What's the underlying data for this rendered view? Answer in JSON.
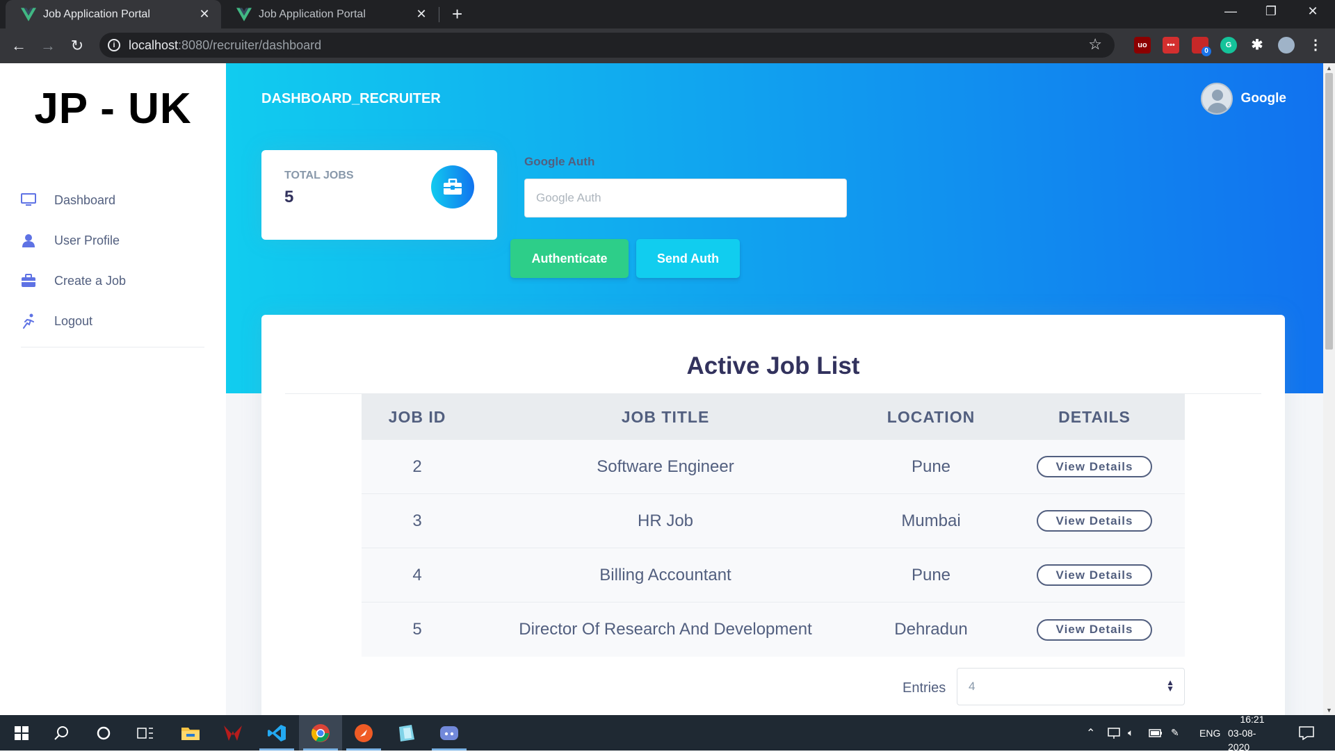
{
  "browser": {
    "tabs": [
      {
        "title": "Job Application Portal",
        "close": "✕"
      },
      {
        "title": "Job Application Portal",
        "close": "✕"
      }
    ],
    "new_tab": "+",
    "url_host": "localhost",
    "url_rest": ":8080/recruiter/dashboard",
    "extension_badge": "0"
  },
  "sidebar": {
    "brand": "JP - UK",
    "items": [
      {
        "label": "Dashboard",
        "icon": "monitor-icon"
      },
      {
        "label": "User Profile",
        "icon": "user-icon"
      },
      {
        "label": "Create a Job",
        "icon": "briefcase-icon"
      },
      {
        "label": "Logout",
        "icon": "run-icon"
      }
    ]
  },
  "header": {
    "title": "DASHBOARD_RECRUITER",
    "user_name": "Google"
  },
  "stats": {
    "label": "TOTAL JOBS",
    "value": "5"
  },
  "auth": {
    "label": "Google Auth",
    "placeholder": "Google Auth",
    "authenticate_label": "Authenticate",
    "send_label": "Send Auth"
  },
  "jobs": {
    "title": "Active Job List",
    "columns": [
      "JOB ID",
      "JOB TITLE",
      "LOCATION",
      "DETAILS"
    ],
    "rows": [
      {
        "id": "2",
        "title": "Software Engineer",
        "location": "Pune",
        "action": "View Details"
      },
      {
        "id": "3",
        "title": "HR Job",
        "location": "Mumbai",
        "action": "View Details"
      },
      {
        "id": "4",
        "title": "Billing Accountant",
        "location": "Pune",
        "action": "View Details"
      },
      {
        "id": "5",
        "title": "Director Of Research And Development",
        "location": "Dehradun",
        "action": "View Details"
      }
    ],
    "entries_label": "Entries",
    "entries_value": "4"
  },
  "taskbar": {
    "language": "ENG",
    "time": "16:21",
    "date": "03-08-2020"
  },
  "colors": {
    "primary_gradient_start": "#11cdef",
    "primary_gradient_end": "#1171ef",
    "success": "#2dce89",
    "info": "#11cdef",
    "text": "#525f7f"
  }
}
